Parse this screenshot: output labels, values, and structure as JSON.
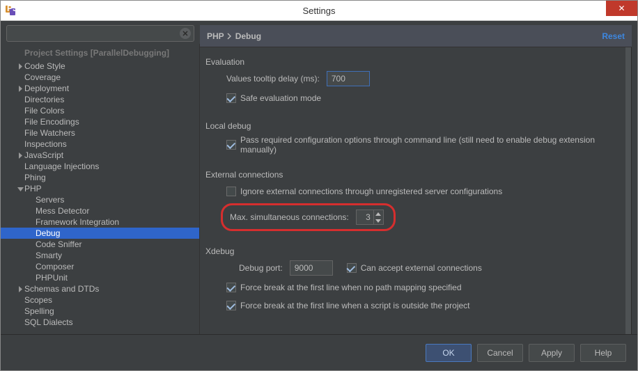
{
  "window": {
    "title": "Settings",
    "close": "✕"
  },
  "sidebar": {
    "header": "Project Settings [ParallelDebugging]",
    "items": [
      {
        "label": "Code Style",
        "arrow": "right",
        "level": 0
      },
      {
        "label": "Coverage",
        "arrow": "",
        "level": 0
      },
      {
        "label": "Deployment",
        "arrow": "right",
        "level": 0
      },
      {
        "label": "Directories",
        "arrow": "",
        "level": 0
      },
      {
        "label": "File Colors",
        "arrow": "",
        "level": 0
      },
      {
        "label": "File Encodings",
        "arrow": "",
        "level": 0
      },
      {
        "label": "File Watchers",
        "arrow": "",
        "level": 0
      },
      {
        "label": "Inspections",
        "arrow": "",
        "level": 0
      },
      {
        "label": "JavaScript",
        "arrow": "right",
        "level": 0
      },
      {
        "label": "Language Injections",
        "arrow": "",
        "level": 0
      },
      {
        "label": "Phing",
        "arrow": "",
        "level": 0
      },
      {
        "label": "PHP",
        "arrow": "down",
        "level": 0
      },
      {
        "label": "Servers",
        "arrow": "",
        "level": 1
      },
      {
        "label": "Mess Detector",
        "arrow": "",
        "level": 1
      },
      {
        "label": "Framework Integration",
        "arrow": "",
        "level": 1
      },
      {
        "label": "Debug",
        "arrow": "",
        "level": 1,
        "selected": true
      },
      {
        "label": "Code Sniffer",
        "arrow": "",
        "level": 1
      },
      {
        "label": "Smarty",
        "arrow": "",
        "level": 1
      },
      {
        "label": "Composer",
        "arrow": "",
        "level": 1
      },
      {
        "label": "PHPUnit",
        "arrow": "",
        "level": 1
      },
      {
        "label": "Schemas and DTDs",
        "arrow": "right",
        "level": 0
      },
      {
        "label": "Scopes",
        "arrow": "",
        "level": 0
      },
      {
        "label": "Spelling",
        "arrow": "",
        "level": 0
      },
      {
        "label": "SQL Dialects",
        "arrow": "",
        "level": 0
      }
    ]
  },
  "breadcrumb": {
    "p1": "PHP",
    "p2": "Debug",
    "reset": "Reset"
  },
  "sections": {
    "evaluation": {
      "title": "Evaluation",
      "tooltip_label": "Values tooltip delay (ms):",
      "tooltip_value": "700",
      "safe_label": "Safe evaluation mode"
    },
    "local": {
      "title": "Local debug",
      "cmdline_label": "Pass required configuration options through command line (still need to enable debug extension manually)"
    },
    "external": {
      "title": "External connections",
      "ignore_label": "Ignore external connections through unregistered server configurations",
      "max_label": "Max. simultaneous connections:",
      "max_value": "3"
    },
    "xdebug": {
      "title": "Xdebug",
      "port_label": "Debug port:",
      "port_value": "9000",
      "accept_label": "Can accept external connections",
      "force1_label": "Force break at the first line when no path mapping specified",
      "force2_label": "Force break at the first line when a script is outside the project"
    }
  },
  "buttons": {
    "ok": "OK",
    "cancel": "Cancel",
    "apply": "Apply",
    "help": "Help"
  }
}
